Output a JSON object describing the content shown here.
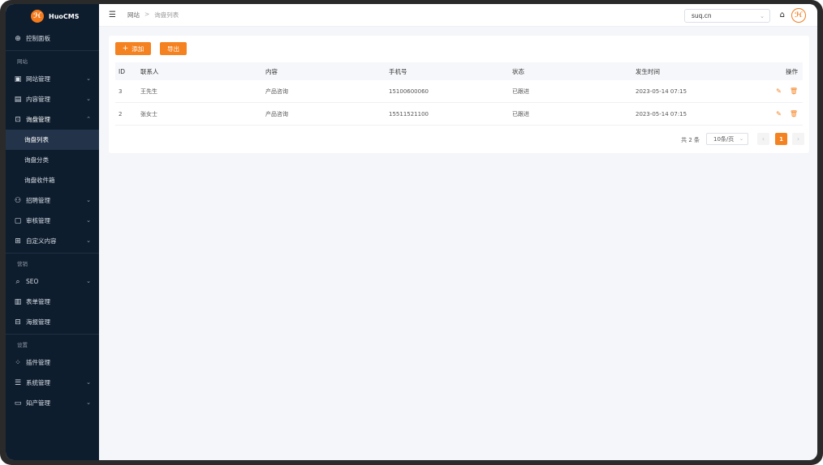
{
  "app": {
    "name": "HuoCMS",
    "logo_glyph": "ℋ"
  },
  "sidebar": {
    "dashboard": {
      "label": "控制面板",
      "icon": "dashboard-icon"
    },
    "section_website": "网站",
    "website_mgmt": {
      "label": "网站管理",
      "icon": "window-icon"
    },
    "content_mgmt": {
      "label": "内容管理",
      "icon": "content-icon"
    },
    "inquiry_mgmt": {
      "label": "询盘管理",
      "icon": "inquiry-icon"
    },
    "inquiry_sub": [
      "询盘列表",
      "询盘分类",
      "询盘收件箱"
    ],
    "recruit_mgmt": {
      "label": "招聘管理",
      "icon": "user-icon"
    },
    "review_mgmt": {
      "label": "审核管理",
      "icon": "review-icon"
    },
    "custom_content": {
      "label": "自定义内容",
      "icon": "custom-icon"
    },
    "section_marketing": "营销",
    "seo": {
      "label": "SEO",
      "icon": "search-icon"
    },
    "form_mgmt": {
      "label": "表单管理",
      "icon": "form-icon"
    },
    "poster_mgmt": {
      "label": "海报管理",
      "icon": "poster-icon"
    },
    "section_settings": "设置",
    "plugin_mgmt": {
      "label": "插件管理",
      "icon": "plugin-icon"
    },
    "system_mgmt": {
      "label": "系统管理",
      "icon": "sliders-icon"
    },
    "ip_mgmt": {
      "label": "知产管理",
      "icon": "folder-icon"
    }
  },
  "topbar": {
    "breadcrumb": [
      "网站",
      "询盘列表"
    ],
    "breadcrumb_sep": ">",
    "site_value": "suq.cn",
    "avatar_glyph": "ℋ"
  },
  "toolbar": {
    "add_label": "添加",
    "add_plus": "+",
    "export_label": "导出"
  },
  "table": {
    "headers": [
      "ID",
      "联系人",
      "内容",
      "手机号",
      "状态",
      "发生时间",
      "操作"
    ],
    "rows": [
      {
        "id": "3",
        "name": "王先生",
        "content": "产品咨询",
        "phone": "15100600060",
        "status": "已跟进",
        "time": "2023-05-14 07:15"
      },
      {
        "id": "2",
        "name": "张女士",
        "content": "产品咨询",
        "phone": "15511521100",
        "status": "已跟进",
        "time": "2023-05-14 07:15"
      }
    ]
  },
  "pagination": {
    "total": "共 2 条",
    "page_size": "10条/页",
    "current_page": "1"
  },
  "colors": {
    "accent": "#f58220",
    "sidebar_bg": "#0e1d2e",
    "sidebar_active": "#23344a"
  }
}
